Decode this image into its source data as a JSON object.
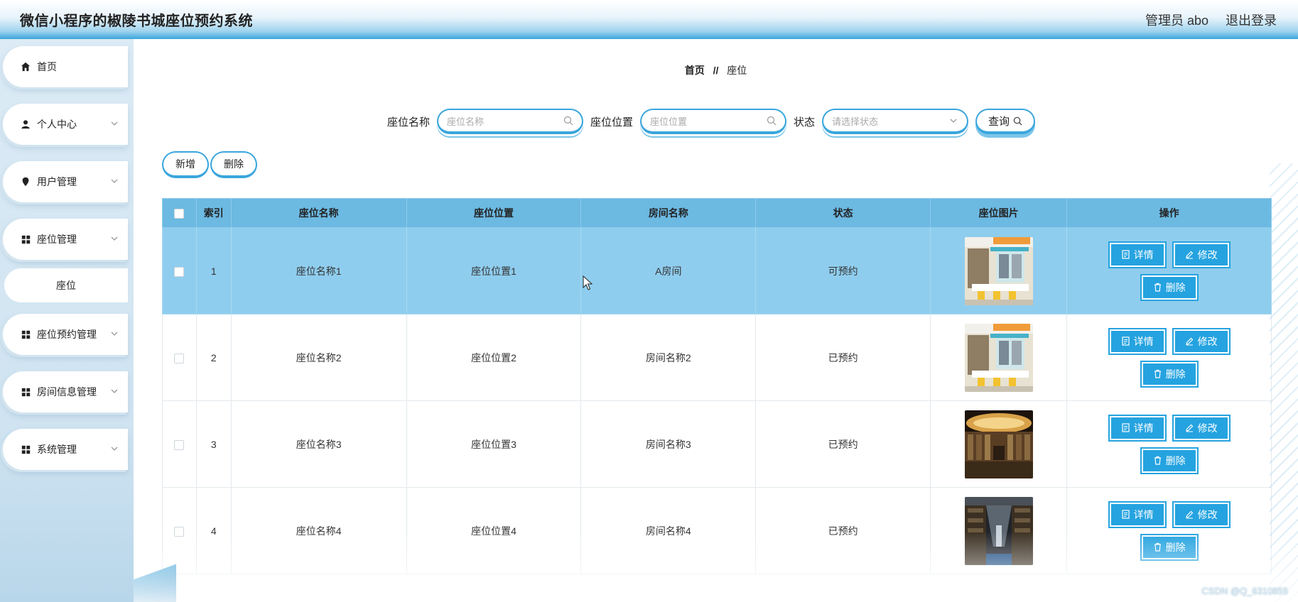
{
  "header": {
    "title": "微信小程序的椒陵书城座位预约系统",
    "admin_label": "管理员 abo",
    "logout_label": "退出登录"
  },
  "sidebar": {
    "items": [
      {
        "label": "首页",
        "icon": "home-icon"
      },
      {
        "label": "个人中心",
        "icon": "user-icon"
      },
      {
        "label": "用户管理",
        "icon": "pin-icon"
      },
      {
        "label": "座位管理",
        "icon": "grid-icon"
      },
      {
        "label": "座位预约管理",
        "icon": "grid-icon"
      },
      {
        "label": "房间信息管理",
        "icon": "grid-icon"
      },
      {
        "label": "系统管理",
        "icon": "grid-icon"
      }
    ],
    "submenu": {
      "label": "座位"
    }
  },
  "breadcrumb": {
    "home": "首页",
    "separator": "//",
    "current": "座位"
  },
  "search": {
    "name_label": "座位名称",
    "name_placeholder": "座位名称",
    "position_label": "座位位置",
    "position_placeholder": "座位位置",
    "status_label": "状态",
    "status_placeholder": "请选择状态",
    "query_label": "查询"
  },
  "actions": {
    "add_label": "新增",
    "delete_label": "删除"
  },
  "table": {
    "headers": [
      "索引",
      "座位名称",
      "座位位置",
      "房间名称",
      "状态",
      "座位图片",
      "操作"
    ],
    "rows": [
      {
        "index": "1",
        "name": "座位名称1",
        "position": "座位位置1",
        "room": "A房间",
        "status": "可预约"
      },
      {
        "index": "2",
        "name": "座位名称2",
        "position": "座位位置2",
        "room": "房间名称2",
        "status": "已预约"
      },
      {
        "index": "3",
        "name": "座位名称3",
        "position": "座位位置3",
        "room": "房间名称3",
        "status": "已预约"
      },
      {
        "index": "4",
        "name": "座位名称4",
        "position": "座位位置4",
        "room": "房间名称4",
        "status": "已预约"
      }
    ],
    "op_detail": "详情",
    "op_edit": "修改",
    "op_delete": "删除"
  },
  "watermark": "CSDN @Q_6310855",
  "colors": {
    "accent": "#3aa6dc",
    "header_row": "#6cb9e2",
    "selected_row": "#8fcdee",
    "op_button": "#25a3e0"
  }
}
